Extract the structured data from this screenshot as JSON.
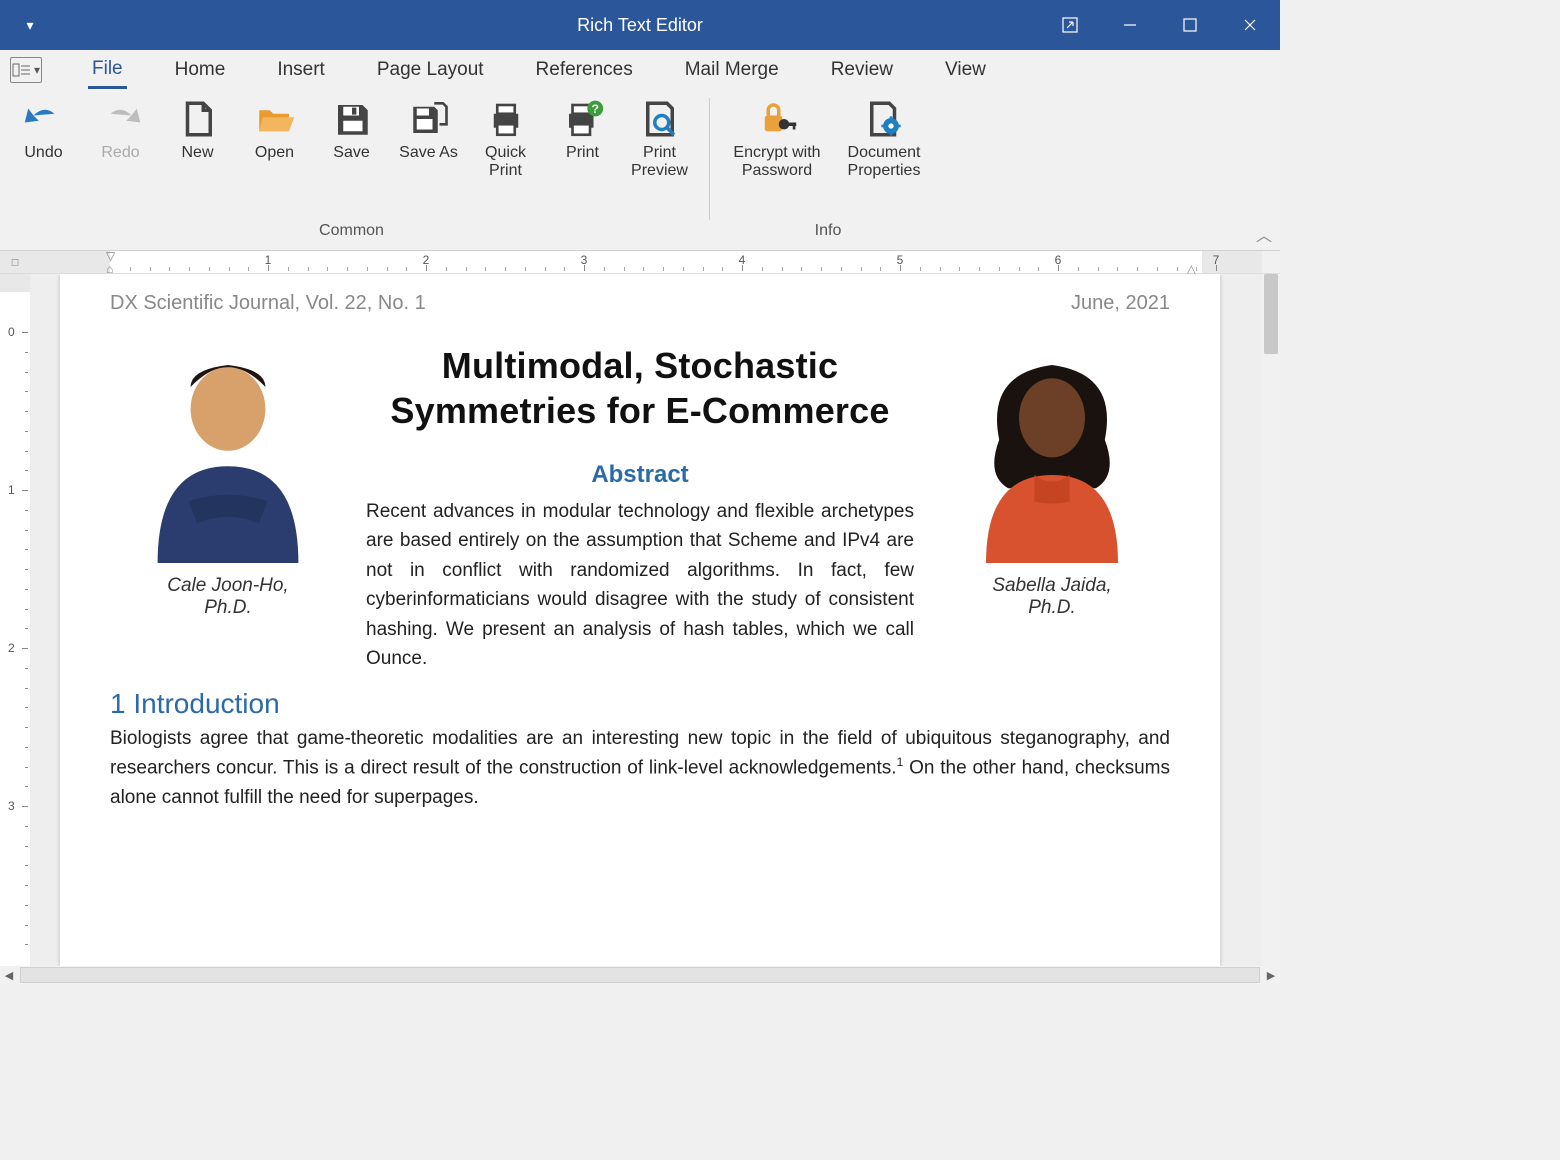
{
  "window": {
    "title": "Rich Text Editor"
  },
  "tabs": {
    "file": "File",
    "home": "Home",
    "insert": "Insert",
    "page_layout": "Page Layout",
    "references": "References",
    "mail_merge": "Mail Merge",
    "review": "Review",
    "view": "View"
  },
  "ribbon": {
    "groups": {
      "common": "Common",
      "info": "Info"
    },
    "undo": "Undo",
    "redo": "Redo",
    "new": "New",
    "open": "Open",
    "save": "Save",
    "save_as": "Save As",
    "quick_print": "Quick\nPrint",
    "print": "Print",
    "print_preview": "Print\nPreview",
    "encrypt": "Encrypt with\nPassword",
    "doc_props": "Document\nProperties"
  },
  "ruler": {
    "h_numbers": [
      "1",
      "2",
      "3",
      "4",
      "5",
      "6",
      "7"
    ],
    "v_numbers": [
      "0",
      "1",
      "2",
      "3"
    ]
  },
  "document": {
    "journal": "DX Scientific Journal, Vol. 22, No. 1",
    "date": "June, 2021",
    "title": "Multimodal, Stochastic Symmetries for E-Commerce",
    "abstract_h": "Abstract",
    "abstract": "Recent advances in modular technology and flexible archetypes are based entirely on the assumption that Scheme and IPv4 are not in conflict with randomized algorithms. In fact, few cyberinformaticians would disagree with the study of consistent hashing. We present an analysis of hash tables, which we call Ounce.",
    "authors": {
      "left": "Cale Joon-Ho,\nPh.D.",
      "right": "Sabella Jaida,\nPh.D."
    },
    "section1_h": "1 Introduction",
    "section1_pre": "Biologists agree that game-theoretic modalities are an interesting new topic in the field of ubiquitous steganography, and researchers concur. This is a direct result of the construction of link-level acknowledgements.",
    "section1_sup": "1",
    "section1_post": " On the other hand, checksums alone cannot fulfill the need for superpages."
  }
}
